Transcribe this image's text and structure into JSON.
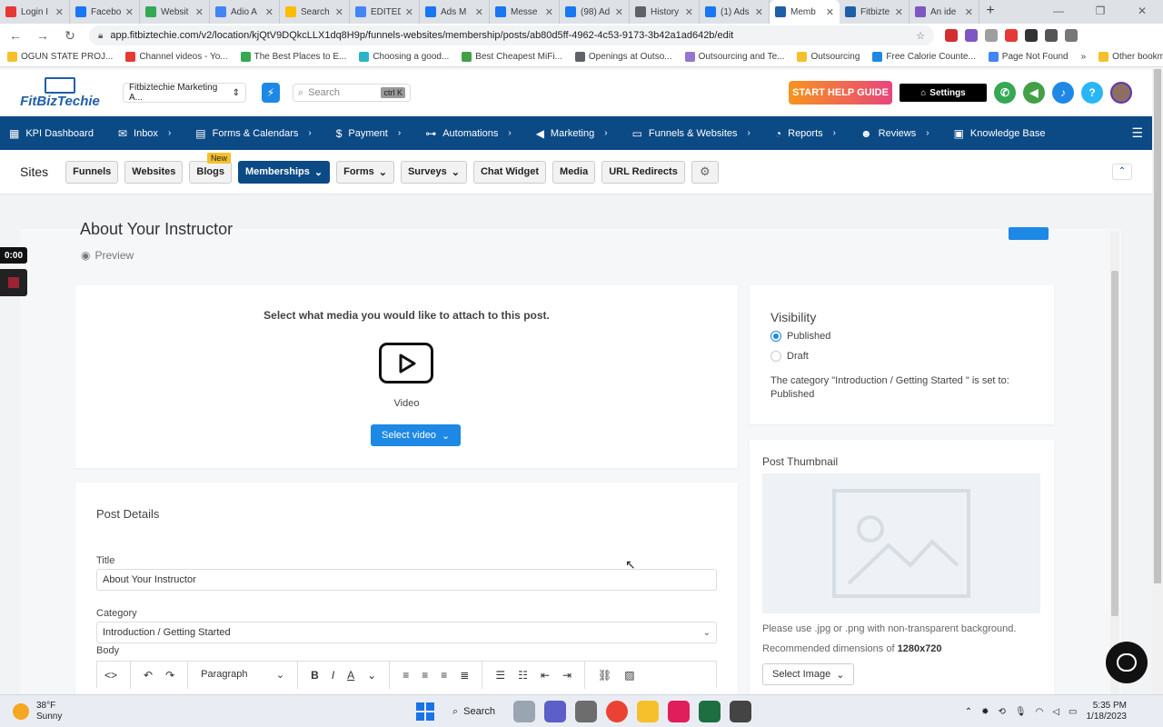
{
  "browser": {
    "tabs": [
      {
        "label": "Login I",
        "color": "#e53935"
      },
      {
        "label": "Facebo",
        "color": "#1877f2"
      },
      {
        "label": "Websit",
        "color": "#34a853"
      },
      {
        "label": "Adio A",
        "color": "#4285f4"
      },
      {
        "label": "Search",
        "color": "#fbbc04"
      },
      {
        "label": "EDITED",
        "color": "#4285f4"
      },
      {
        "label": "Ads M",
        "color": "#1877f2"
      },
      {
        "label": "Messe",
        "color": "#1877f2"
      },
      {
        "label": "(98) Ad",
        "color": "#1877f2"
      },
      {
        "label": "History",
        "color": "#5f6368"
      },
      {
        "label": "(1) Ads",
        "color": "#1877f2"
      },
      {
        "label": "Memb",
        "color": "#1f5fa8"
      },
      {
        "label": "Fitbizte",
        "color": "#1f5fa8"
      },
      {
        "label": "An ide",
        "color": "#7e57c2"
      }
    ],
    "url": "app.fitbiztechie.com/v2/location/kjQtV9DQkcLLX1dq8H9p/funnels-websites/membership/posts/ab80d5ff-4962-4c53-9173-3b42a1ad642b/edit",
    "bookmarks": [
      "OGUN STATE PROJ...",
      "Channel videos - Yo...",
      "The Best Places to E...",
      "Choosing a good...",
      "Best Cheapest MiFi...",
      "Openings at Outso...",
      "Outsourcing and Te...",
      "Outsourcing",
      "Free Calorie Counte...",
      "Page Not Found"
    ],
    "bookmarks_more": "»",
    "other_bookmarks": "Other bookmarks"
  },
  "header": {
    "logo_text": "FitBizTechie",
    "location": "Fitbiztechie Marketing A...",
    "search_placeholder": "Search",
    "search_shortcut": "ctrl K",
    "help_guide": "START HELP GUIDE",
    "settings": "Settings"
  },
  "nav": {
    "items": [
      {
        "label": "KPI Dashboard",
        "icon": "grid-icon",
        "glyph": "▦"
      },
      {
        "label": "Inbox",
        "icon": "inbox-icon",
        "glyph": "✉"
      },
      {
        "label": "Forms & Calendars",
        "icon": "calendar-icon",
        "glyph": "▤"
      },
      {
        "label": "Payment",
        "icon": "dollar-icon",
        "glyph": "$"
      },
      {
        "label": "Automations",
        "icon": "sitemap-icon",
        "glyph": "⊶"
      },
      {
        "label": "Marketing",
        "icon": "megaphone-icon",
        "glyph": "◀"
      },
      {
        "label": "Funnels & Websites",
        "icon": "monitor-icon",
        "glyph": "▭"
      },
      {
        "label": "Reports",
        "icon": "piechart-icon",
        "glyph": "◔"
      },
      {
        "label": "Reviews",
        "icon": "smile-icon",
        "glyph": "☻"
      },
      {
        "label": "Knowledge Base",
        "icon": "book-icon",
        "glyph": "▣"
      }
    ]
  },
  "subnav": {
    "title": "Sites",
    "buttons": [
      {
        "label": "Funnels",
        "active": false,
        "caret": false
      },
      {
        "label": "Websites",
        "active": false,
        "caret": false
      },
      {
        "label": "Blogs",
        "active": false,
        "caret": false,
        "badge": "New"
      },
      {
        "label": "Memberships",
        "active": true,
        "caret": true
      },
      {
        "label": "Forms",
        "active": false,
        "caret": true
      },
      {
        "label": "Surveys",
        "active": false,
        "caret": true
      },
      {
        "label": "Chat Widget",
        "active": false,
        "caret": false
      },
      {
        "label": "Media",
        "active": false,
        "caret": false
      },
      {
        "label": "URL Redirects",
        "active": false,
        "caret": false
      }
    ]
  },
  "post": {
    "title": "About Your Instructor",
    "preview": "Preview"
  },
  "media": {
    "prompt": "Select what media you would like to attach to this post.",
    "video_label": "Video",
    "select_video": "Select video"
  },
  "details": {
    "section_title": "Post Details",
    "title_label": "Title",
    "title_value": "About Your Instructor",
    "category_label": "Category",
    "category_value": "Introduction / Getting Started",
    "body_label": "Body",
    "toolbar_paragraph": "Paragraph"
  },
  "visibility": {
    "title": "Visibility",
    "published": "Published",
    "draft": "Draft",
    "note": "The category \"Introduction / Getting Started \" is set to: Published"
  },
  "thumbnail": {
    "title": "Post Thumbnail",
    "note1": "Please use .jpg or .png with non-transparent background.",
    "note2_prefix": "Recommended dimensions of",
    "note2_value": "1280x720",
    "select_image": "Select Image"
  },
  "recorder": {
    "timer": "0:00"
  },
  "taskbar": {
    "temp": "38°F",
    "weather": "Sunny",
    "search": "Search",
    "time": "5:35 PM",
    "date": "1/18/2023"
  }
}
